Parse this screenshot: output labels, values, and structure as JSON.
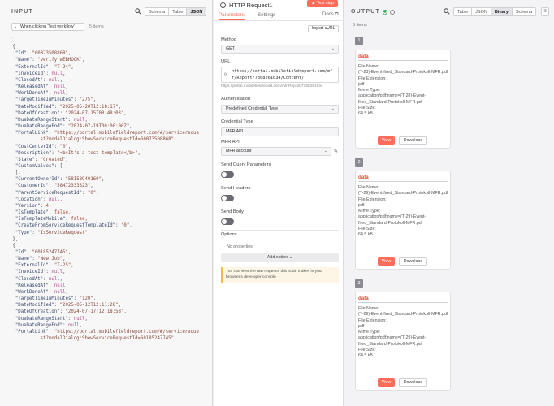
{
  "input": {
    "title": "INPUT",
    "views": [
      "Schema",
      "Table",
      "JSON"
    ],
    "active_view": "JSON",
    "trigger_select": "When clicking 'Test workflow'",
    "item_count": "5 items"
  },
  "node": {
    "title": "HTTP Request1",
    "test_step": "Test step",
    "tab_parameters": "Parameters",
    "tab_settings": "Settings",
    "docs": "Docs",
    "import_curl": "Import cURL",
    "method_label": "Method",
    "method_value": "GET",
    "url_label": "URL",
    "url_fx": "fx",
    "url_value": "https://portal.mobilefieldreport.com/mfr/Report/7368261634/Content/",
    "url_preview": "https://portal.mobilefieldreport.com/mfr/Report/7368261634",
    "auth_label": "Authentication",
    "auth_value": "Predefined Credential Type",
    "cred_type_label": "Credential Type",
    "cred_type_value": "MFR API",
    "mfr_api_label": "MFR API",
    "mfr_api_value": "MFR account",
    "send_query": "Send Query Parameters",
    "send_headers": "Send Headers",
    "send_body": "Send Body",
    "options_label": "Options",
    "no_properties": "No properties",
    "add_option": "Add option",
    "notice": "You can view the raw requests this node makes in your browser's developer console"
  },
  "output": {
    "title": "OUTPUT",
    "views": [
      "Table",
      "JSON",
      "Binary",
      "Schema"
    ],
    "active_view": "Binary",
    "item_count": "5 items",
    "items": [
      {
        "index": "1",
        "title": "data",
        "file_name_label": "File Name:",
        "file_name": "(T-28)-Event-fired_Standard-Protokoll-MFR.pdf",
        "ext_label": "File Extension:",
        "ext": "pdf",
        "mime_label": "Mime Type:",
        "mime": "application/pdf;name=(T-28)-Event-fired_Standard-Protokoll-MFR.pdf",
        "size_label": "File Size:",
        "size": "64.5 kB",
        "view": "View",
        "download": "Download"
      },
      {
        "index": "2",
        "title": "data",
        "file_name_label": "File Name:",
        "file_name": "(T-29)-Event-fired_Standard-Protokoll-MFR.pdf",
        "ext_label": "File Extension:",
        "ext": "pdf",
        "mime_label": "Mime Type:",
        "mime": "application/pdf;name=(T-29)-Event-fired_Standard-Protokoll-MFR.pdf",
        "size_label": "File Size:",
        "size": "64.5 kB",
        "view": "View",
        "download": "Download"
      },
      {
        "index": "3",
        "title": "data",
        "file_name_label": "File Name:",
        "file_name": "(T-29)-Event-fired_Standard-Protokoll-MFR.pdf",
        "ext_label": "File Extension:",
        "ext": "pdf",
        "mime_label": "Mime Type:",
        "mime": "application/pdf;name=(T-29)-Event-fired_Standard-Protokoll-MFR.pdf",
        "size_label": "File Size:",
        "size": "64.5 kB",
        "view": "View",
        "download": "Download"
      }
    ]
  },
  "json_lines": [
    [
      [
        "p",
        "["
      ]
    ],
    [
      [
        "p",
        " {"
      ]
    ],
    [
      [
        "k",
        "  \"Id\""
      ],
      [
        "p",
        ": "
      ],
      [
        "s",
        "\"60073508868\""
      ],
      [
        "p",
        ","
      ]
    ],
    [
      [
        "k",
        "  \"Name\""
      ],
      [
        "p",
        ": "
      ],
      [
        "s",
        "\"verify wEBHOOK\""
      ],
      [
        "p",
        ","
      ]
    ],
    [
      [
        "k",
        "  \"ExternalId\""
      ],
      [
        "p",
        ": "
      ],
      [
        "s",
        "\"T-24\""
      ],
      [
        "p",
        ","
      ]
    ],
    [
      [
        "k",
        "  \"InvoiceId\""
      ],
      [
        "p",
        ": "
      ],
      [
        "nl",
        "null"
      ],
      [
        "p",
        ","
      ]
    ],
    [
      [
        "k",
        "  \"ClosedAt\""
      ],
      [
        "p",
        ": "
      ],
      [
        "nl",
        "null"
      ],
      [
        "p",
        ","
      ]
    ],
    [
      [
        "k",
        "  \"ReleasedAt\""
      ],
      [
        "p",
        ": "
      ],
      [
        "nl",
        "null"
      ],
      [
        "p",
        ","
      ]
    ],
    [
      [
        "k",
        "  \"WorkDoneAt\""
      ],
      [
        "p",
        ": "
      ],
      [
        "nl",
        "null"
      ],
      [
        "p",
        ","
      ]
    ],
    [
      [
        "k",
        "  \"TargetTimeInMinutes\""
      ],
      [
        "p",
        ": "
      ],
      [
        "s",
        "\"275\""
      ],
      [
        "p",
        ","
      ]
    ],
    [
      [
        "k",
        "  \"DateModified\""
      ],
      [
        "p",
        ": "
      ],
      [
        "s",
        "\"2025-05-20T12:18:17\""
      ],
      [
        "p",
        ","
      ]
    ],
    [
      [
        "k",
        "  \"DateOfCreation\""
      ],
      [
        "p",
        ": "
      ],
      [
        "s",
        "\"2024-07-15T08:48:03\""
      ],
      [
        "p",
        ","
      ]
    ],
    [
      [
        "k",
        "  \"DueDateRangeStart\""
      ],
      [
        "p",
        ": "
      ],
      [
        "nl",
        "null"
      ],
      [
        "p",
        ","
      ]
    ],
    [
      [
        "k",
        "  \"DueDateRangeEnd\""
      ],
      [
        "p",
        ": "
      ],
      [
        "s",
        "\"2024-07-19T00:00:00Z\""
      ],
      [
        "p",
        ","
      ]
    ],
    [
      [
        "k",
        "  \"PortalLink\""
      ],
      [
        "p",
        ": "
      ],
      [
        "s",
        "\"https://portal.mobilefieldreport.com/#/servicereque"
      ]
    ],
    [
      [
        "s",
        "           st?modalDialog:ShowServiceRequestId=60073508868\""
      ],
      [
        "p",
        ","
      ]
    ],
    [
      [
        "k",
        "  \"CostCenterId\""
      ],
      [
        "p",
        ": "
      ],
      [
        "s",
        "\"0\""
      ],
      [
        "p",
        ","
      ]
    ],
    [
      [
        "k",
        "  \"Description\""
      ],
      [
        "p",
        ": "
      ],
      [
        "s",
        "\"<b>It's a test template</b>\""
      ],
      [
        "p",
        ","
      ]
    ],
    [
      [
        "k",
        "  \"State\""
      ],
      [
        "p",
        ": "
      ],
      [
        "s",
        "\"Created\""
      ],
      [
        "p",
        ","
      ]
    ],
    [
      [
        "k",
        "  \"CustomValues\""
      ],
      [
        "p",
        ": ["
      ]
    ],
    [
      [
        "p",
        "  ],"
      ]
    ],
    [
      [
        "k",
        "  \"CurrentOwnerId\""
      ],
      [
        "p",
        ": "
      ],
      [
        "s",
        "\"58158940160\""
      ],
      [
        "p",
        ","
      ]
    ],
    [
      [
        "k",
        "  \"CustomerId\""
      ],
      [
        "p",
        ": "
      ],
      [
        "s",
        "\"58472333323\""
      ],
      [
        "p",
        ","
      ]
    ],
    [
      [
        "k",
        "  \"ParentServiceRequestId\""
      ],
      [
        "p",
        ": "
      ],
      [
        "s",
        "\"0\""
      ],
      [
        "p",
        ","
      ]
    ],
    [
      [
        "k",
        "  \"Location\""
      ],
      [
        "p",
        ": "
      ],
      [
        "nl",
        "null"
      ],
      [
        "p",
        ","
      ]
    ],
    [
      [
        "k",
        "  \"Version\""
      ],
      [
        "p",
        ": "
      ],
      [
        "n",
        "4"
      ],
      [
        "p",
        ","
      ]
    ],
    [
      [
        "k",
        "  \"IsTemplate\""
      ],
      [
        "p",
        ": "
      ],
      [
        "b",
        "false"
      ],
      [
        "p",
        ","
      ]
    ],
    [
      [
        "k",
        "  \"IsTemplateMobile\""
      ],
      [
        "p",
        ": "
      ],
      [
        "b",
        "false"
      ],
      [
        "p",
        ","
      ]
    ],
    [
      [
        "k",
        "  \"CreateFromServiceRequestTemplateId\""
      ],
      [
        "p",
        ": "
      ],
      [
        "s",
        "\"0\""
      ],
      [
        "p",
        ","
      ]
    ],
    [
      [
        "k",
        "  \"Type\""
      ],
      [
        "p",
        ": "
      ],
      [
        "s",
        "\"IsServiceRequest\""
      ]
    ],
    [
      [
        "p",
        " },"
      ]
    ],
    [
      [
        "p",
        " {"
      ]
    ],
    [
      [
        "k",
        "  \"Id\""
      ],
      [
        "p",
        ": "
      ],
      [
        "s",
        "\"60185247745\""
      ],
      [
        "p",
        ","
      ]
    ],
    [
      [
        "k",
        "  \"Name\""
      ],
      [
        "p",
        ": "
      ],
      [
        "s",
        "\"New Job\""
      ],
      [
        "p",
        ","
      ]
    ],
    [
      [
        "k",
        "  \"ExternalId\""
      ],
      [
        "p",
        ": "
      ],
      [
        "s",
        "\"T-25\""
      ],
      [
        "p",
        ","
      ]
    ],
    [
      [
        "k",
        "  \"InvoiceId\""
      ],
      [
        "p",
        ": "
      ],
      [
        "nl",
        "null"
      ],
      [
        "p",
        ","
      ]
    ],
    [
      [
        "k",
        "  \"ClosedAt\""
      ],
      [
        "p",
        ": "
      ],
      [
        "nl",
        "null"
      ],
      [
        "p",
        ","
      ]
    ],
    [
      [
        "k",
        "  \"ReleasedAt\""
      ],
      [
        "p",
        ": "
      ],
      [
        "nl",
        "null"
      ],
      [
        "p",
        ","
      ]
    ],
    [
      [
        "k",
        "  \"WorkDoneAt\""
      ],
      [
        "p",
        ": "
      ],
      [
        "nl",
        "null"
      ],
      [
        "p",
        ","
      ]
    ],
    [
      [
        "k",
        "  \"TargetTimeInMinutes\""
      ],
      [
        "p",
        ": "
      ],
      [
        "s",
        "\"120\""
      ],
      [
        "p",
        ","
      ]
    ],
    [
      [
        "k",
        "  \"DateModified\""
      ],
      [
        "p",
        ": "
      ],
      [
        "s",
        "\"2025-05-12T12:11:28\""
      ],
      [
        "p",
        ","
      ]
    ],
    [
      [
        "k",
        "  \"DateOfCreation\""
      ],
      [
        "p",
        ": "
      ],
      [
        "s",
        "\"2024-07-17T12:18:58\""
      ],
      [
        "p",
        ","
      ]
    ],
    [
      [
        "k",
        "  \"DueDateRangeStart\""
      ],
      [
        "p",
        ": "
      ],
      [
        "nl",
        "null"
      ],
      [
        "p",
        ","
      ]
    ],
    [
      [
        "k",
        "  \"DueDateRangeEnd\""
      ],
      [
        "p",
        ": "
      ],
      [
        "nl",
        "null"
      ],
      [
        "p",
        ","
      ]
    ],
    [
      [
        "k",
        "  \"PortalLink\""
      ],
      [
        "p",
        ": "
      ],
      [
        "s",
        "\"https://portal.mobilefieldreport.com/#/servicereque"
      ]
    ],
    [
      [
        "s",
        "           st?modalDialog:ShowServiceRequestId=60185247745\""
      ],
      [
        "p",
        ","
      ]
    ]
  ]
}
